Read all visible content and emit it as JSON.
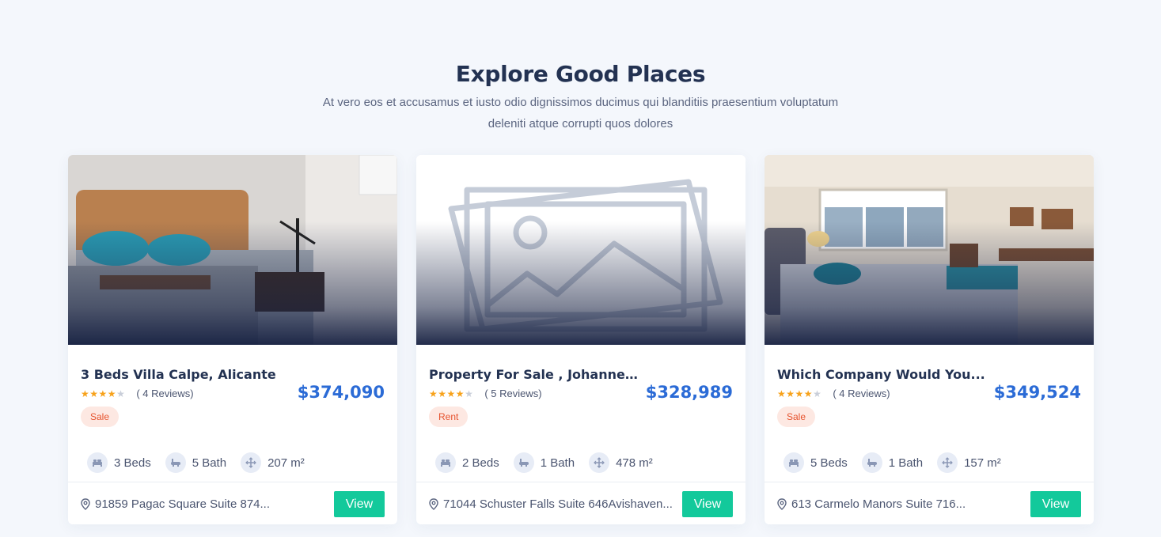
{
  "section": {
    "title": "Explore Good Places",
    "subtitle_line1": "At vero eos et accusamus et iusto odio dignissimos ducimus qui blanditiis praesentium voluptatum",
    "subtitle_line2": "deleniti atque corrupti quos dolores"
  },
  "colors": {
    "accent": "#2b6bd6",
    "view_button": "#13c99b",
    "tag_bg": "#fde8e2",
    "tag_text": "#e6532e",
    "star": "#f7a21b"
  },
  "cards": [
    {
      "name": "3 Beds Villa Calpe, Alicante",
      "rating": 4,
      "reviews": "( 4 Reviews)",
      "tag": "Sale",
      "price": "$374,090",
      "beds": "3 Beds",
      "baths": "5 Bath",
      "area": "207 m²",
      "address": "91859 Pagac Square Suite 874...",
      "view_label": "View"
    },
    {
      "name": "Property For Sale , Johannesbur...",
      "rating": 4,
      "reviews": "( 5 Reviews)",
      "tag": "Rent",
      "price": "$328,989",
      "beds": "2 Beds",
      "baths": "1 Bath",
      "area": "478 m²",
      "address": "71044 Schuster Falls Suite 646Avishaven...",
      "view_label": "View"
    },
    {
      "name": "Which Company Would You...",
      "rating": 4,
      "reviews": "( 4 Reviews)",
      "tag": "Sale",
      "price": "$349,524",
      "beds": "5 Beds",
      "baths": "1 Bath",
      "area": "157 m²",
      "address": "613 Carmelo Manors Suite 716...",
      "view_label": "View"
    }
  ],
  "icons": {
    "beds": "bed-icon",
    "baths": "bath-icon",
    "area": "area-icon",
    "address": "map-pin-icon",
    "rating": "star-icon"
  }
}
